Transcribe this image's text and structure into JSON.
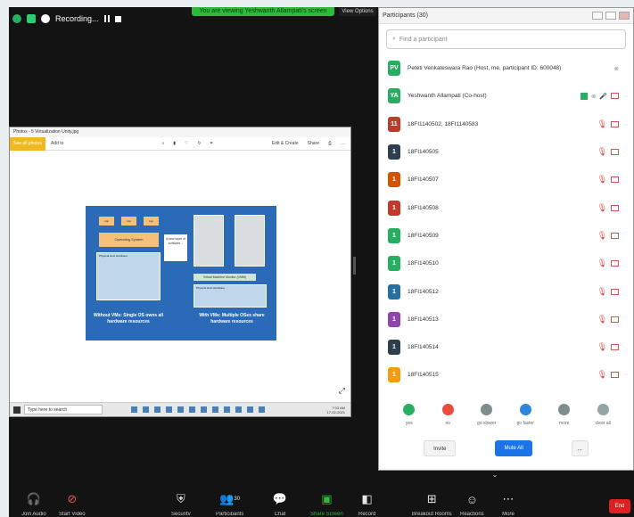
{
  "recording": {
    "label": "Recording..."
  },
  "banner": {
    "viewing": "You are viewing Yeshwanth Allampati's screen",
    "view_options": "View Options"
  },
  "share": {
    "window_title": "Photos - 5 Virtualization Unity.jpg",
    "toolbar_left": "See all photos",
    "toolbar_add": "Add to",
    "toolbar_edit": "Edit & Create",
    "toolbar_share": "Share",
    "slide": {
      "apps": [
        "App",
        "App",
        "App"
      ],
      "os": "Operating System",
      "hardware": "Physical Host Hardware",
      "callout": "A new layer of software...",
      "vmm": "Virtual Machine Monitor (VMM)",
      "hardware_right": "Physical Host Hardware",
      "caption_left": "Without VMs: Single OS owns all hardware resources",
      "caption_right": "With VMs: Multiple OSes share hardware resources"
    },
    "taskbar_search": "Type here to search",
    "taskbar_time": "7:03 AM",
    "taskbar_date": "17-02-2021"
  },
  "participants": {
    "title": "Participants (30)",
    "search_placeholder": "Find a participant",
    "rows": [
      {
        "initials": "PV",
        "color": "#27ae60",
        "name": "Peteti Venkateswara Rao (Host, me, participant ID: 600048)"
      },
      {
        "initials": "YA",
        "color": "#27ae60",
        "name": "Yeshwanth Allampati (Co-host)"
      },
      {
        "initials": "11",
        "color": "#c0392b",
        "name": "18FI1140502, 18FI1140583"
      },
      {
        "initials": "1",
        "color": "#2c3e50",
        "name": "18FI140505"
      },
      {
        "initials": "1",
        "color": "#d35400",
        "name": "18FI140507"
      },
      {
        "initials": "1",
        "color": "#c0392b",
        "name": "18FI140508"
      },
      {
        "initials": "1",
        "color": "#27ae60",
        "name": "18FI140509"
      },
      {
        "initials": "1",
        "color": "#27ae60",
        "name": "18FI140510"
      },
      {
        "initials": "1",
        "color": "#2471a3",
        "name": "18FI140512"
      },
      {
        "initials": "1",
        "color": "#8e44ad",
        "name": "18FI140513"
      },
      {
        "initials": "1",
        "color": "#2c3e50",
        "name": "18FI140514"
      },
      {
        "initials": "1",
        "color": "#f39c12",
        "name": "18FI140515"
      }
    ],
    "status": [
      {
        "label": "yes",
        "color": "#27ae60"
      },
      {
        "label": "no",
        "color": "#e74c3c"
      },
      {
        "label": "go slower",
        "color": "#7f8c8d"
      },
      {
        "label": "go faster",
        "color": "#2e86de"
      },
      {
        "label": "more",
        "color": "#7f8c8d"
      },
      {
        "label": "clear all",
        "color": "#95a5a6"
      }
    ],
    "invite": "Invite",
    "mute_all": "Mute All",
    "more": "..."
  },
  "toolbar": {
    "join_audio": "Join Audio",
    "start_video": "Start Video",
    "security": "Security",
    "participants": "Participants",
    "participants_count": "30",
    "chat": "Chat",
    "share_screen": "Share Screen",
    "record": "Record",
    "reactions": "Reactions",
    "breakout": "Breakout Rooms",
    "more": "More",
    "end": "End"
  }
}
